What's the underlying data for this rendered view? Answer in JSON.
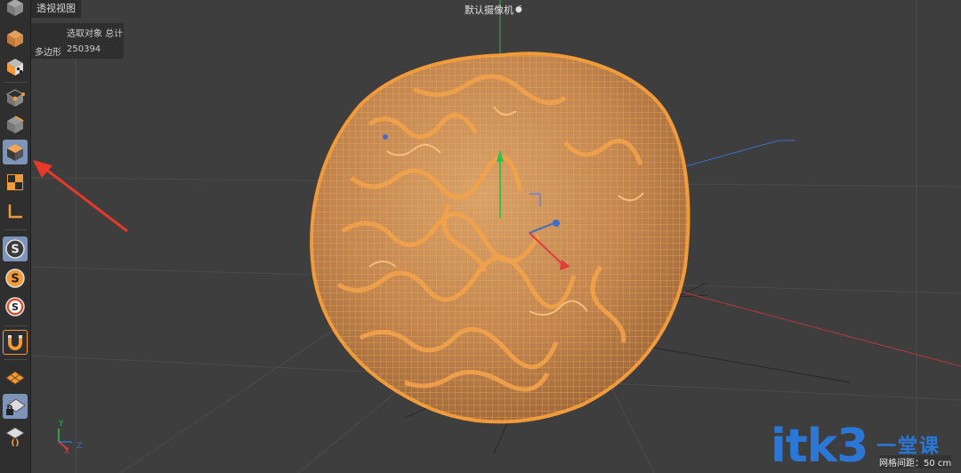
{
  "viewport": {
    "menu_label": "透视视图",
    "camera_label": "默认摄像机",
    "camera_icon": "camera-dots-icon"
  },
  "info_panel": {
    "header_selected": "选取对象",
    "header_total": "总计",
    "polygon_label": "多边形",
    "polygon_count": "250394"
  },
  "axes": {
    "y": "Y",
    "x": "X",
    "z": "Z"
  },
  "grid_info": "网格间距：50 cm",
  "watermark": {
    "text": "itk3",
    "cn": "一堂课"
  },
  "colors": {
    "accent_orange": "#f09a3a",
    "toolbar_active": "#7d95b8",
    "viewport_bg": "#3e3e3e",
    "annotation_arrow": "#e8382a"
  },
  "toolbar": {
    "items": [
      {
        "name": "view-mode-icon"
      },
      {
        "name": "model-mode-icon"
      },
      {
        "name": "texture-mode-icon"
      },
      {
        "name": "points-mode-icon"
      },
      {
        "name": "edges-mode-icon"
      },
      {
        "name": "polygons-mode-icon"
      },
      {
        "name": "uv-mode-icon"
      },
      {
        "name": "axis-mode-icon"
      },
      {
        "name": "snap-icon"
      },
      {
        "name": "snap-settings-icon"
      },
      {
        "name": "snap-toggle-icon"
      },
      {
        "name": "magnet-icon"
      },
      {
        "name": "workplane-icon"
      },
      {
        "name": "lock-workplane-icon"
      },
      {
        "name": "workplane-align-icon"
      }
    ]
  }
}
